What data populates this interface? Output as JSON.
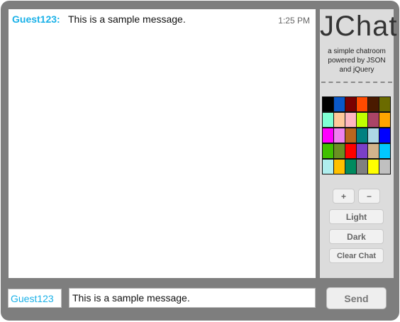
{
  "chat": {
    "messages": [
      {
        "user": "Guest123:",
        "text": "This is a sample message.",
        "time": "1:25 PM"
      }
    ]
  },
  "sidebar": {
    "logo": "JChat",
    "tagline": "a simple chatroom powered by JSON and jQuery",
    "palette": [
      "#000000",
      "#0a58c8",
      "#7a0000",
      "#ff4a00",
      "#4a1a00",
      "#6b6b00",
      "#7fffd4",
      "#ffc89a",
      "#ffb6c1",
      "#c0ff00",
      "#aa4466",
      "#ffa500",
      "#ff00ff",
      "#ee82ee",
      "#b8661e",
      "#008080",
      "#add8e6",
      "#0000ff",
      "#40c000",
      "#6b8e23",
      "#ff0000",
      "#7b3fc8",
      "#d2b48c",
      "#00c8ff",
      "#afeeee",
      "#ffc000",
      "#008a5e",
      "#808080",
      "#ffff00",
      "#c0c0c0"
    ],
    "buttons": {
      "plus": "+",
      "minus": "−",
      "light": "Light",
      "dark": "Dark",
      "clear": "Clear Chat"
    }
  },
  "footer": {
    "name_value": "Guest123",
    "message_value": "This is a sample message.",
    "send_label": "Send"
  }
}
